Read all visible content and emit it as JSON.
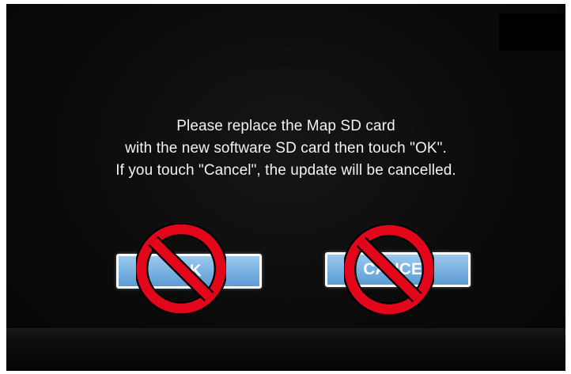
{
  "dialog": {
    "message_lines": [
      "Please replace the Map SD card",
      "with the new software SD card then touch \"OK\".",
      "If you touch \"Cancel\", the update will be cancelled."
    ],
    "ok_label": "OK",
    "cancel_label": "CANCEL"
  },
  "overlay": {
    "prohibition_icon": "no-symbol-icon",
    "prohibition_color": "#e3051a"
  },
  "colors": {
    "screen_background": "#0b0b0b",
    "text": "#f2f2f2",
    "button_fill": "#7ab3e2",
    "button_border": "#ffffff"
  }
}
